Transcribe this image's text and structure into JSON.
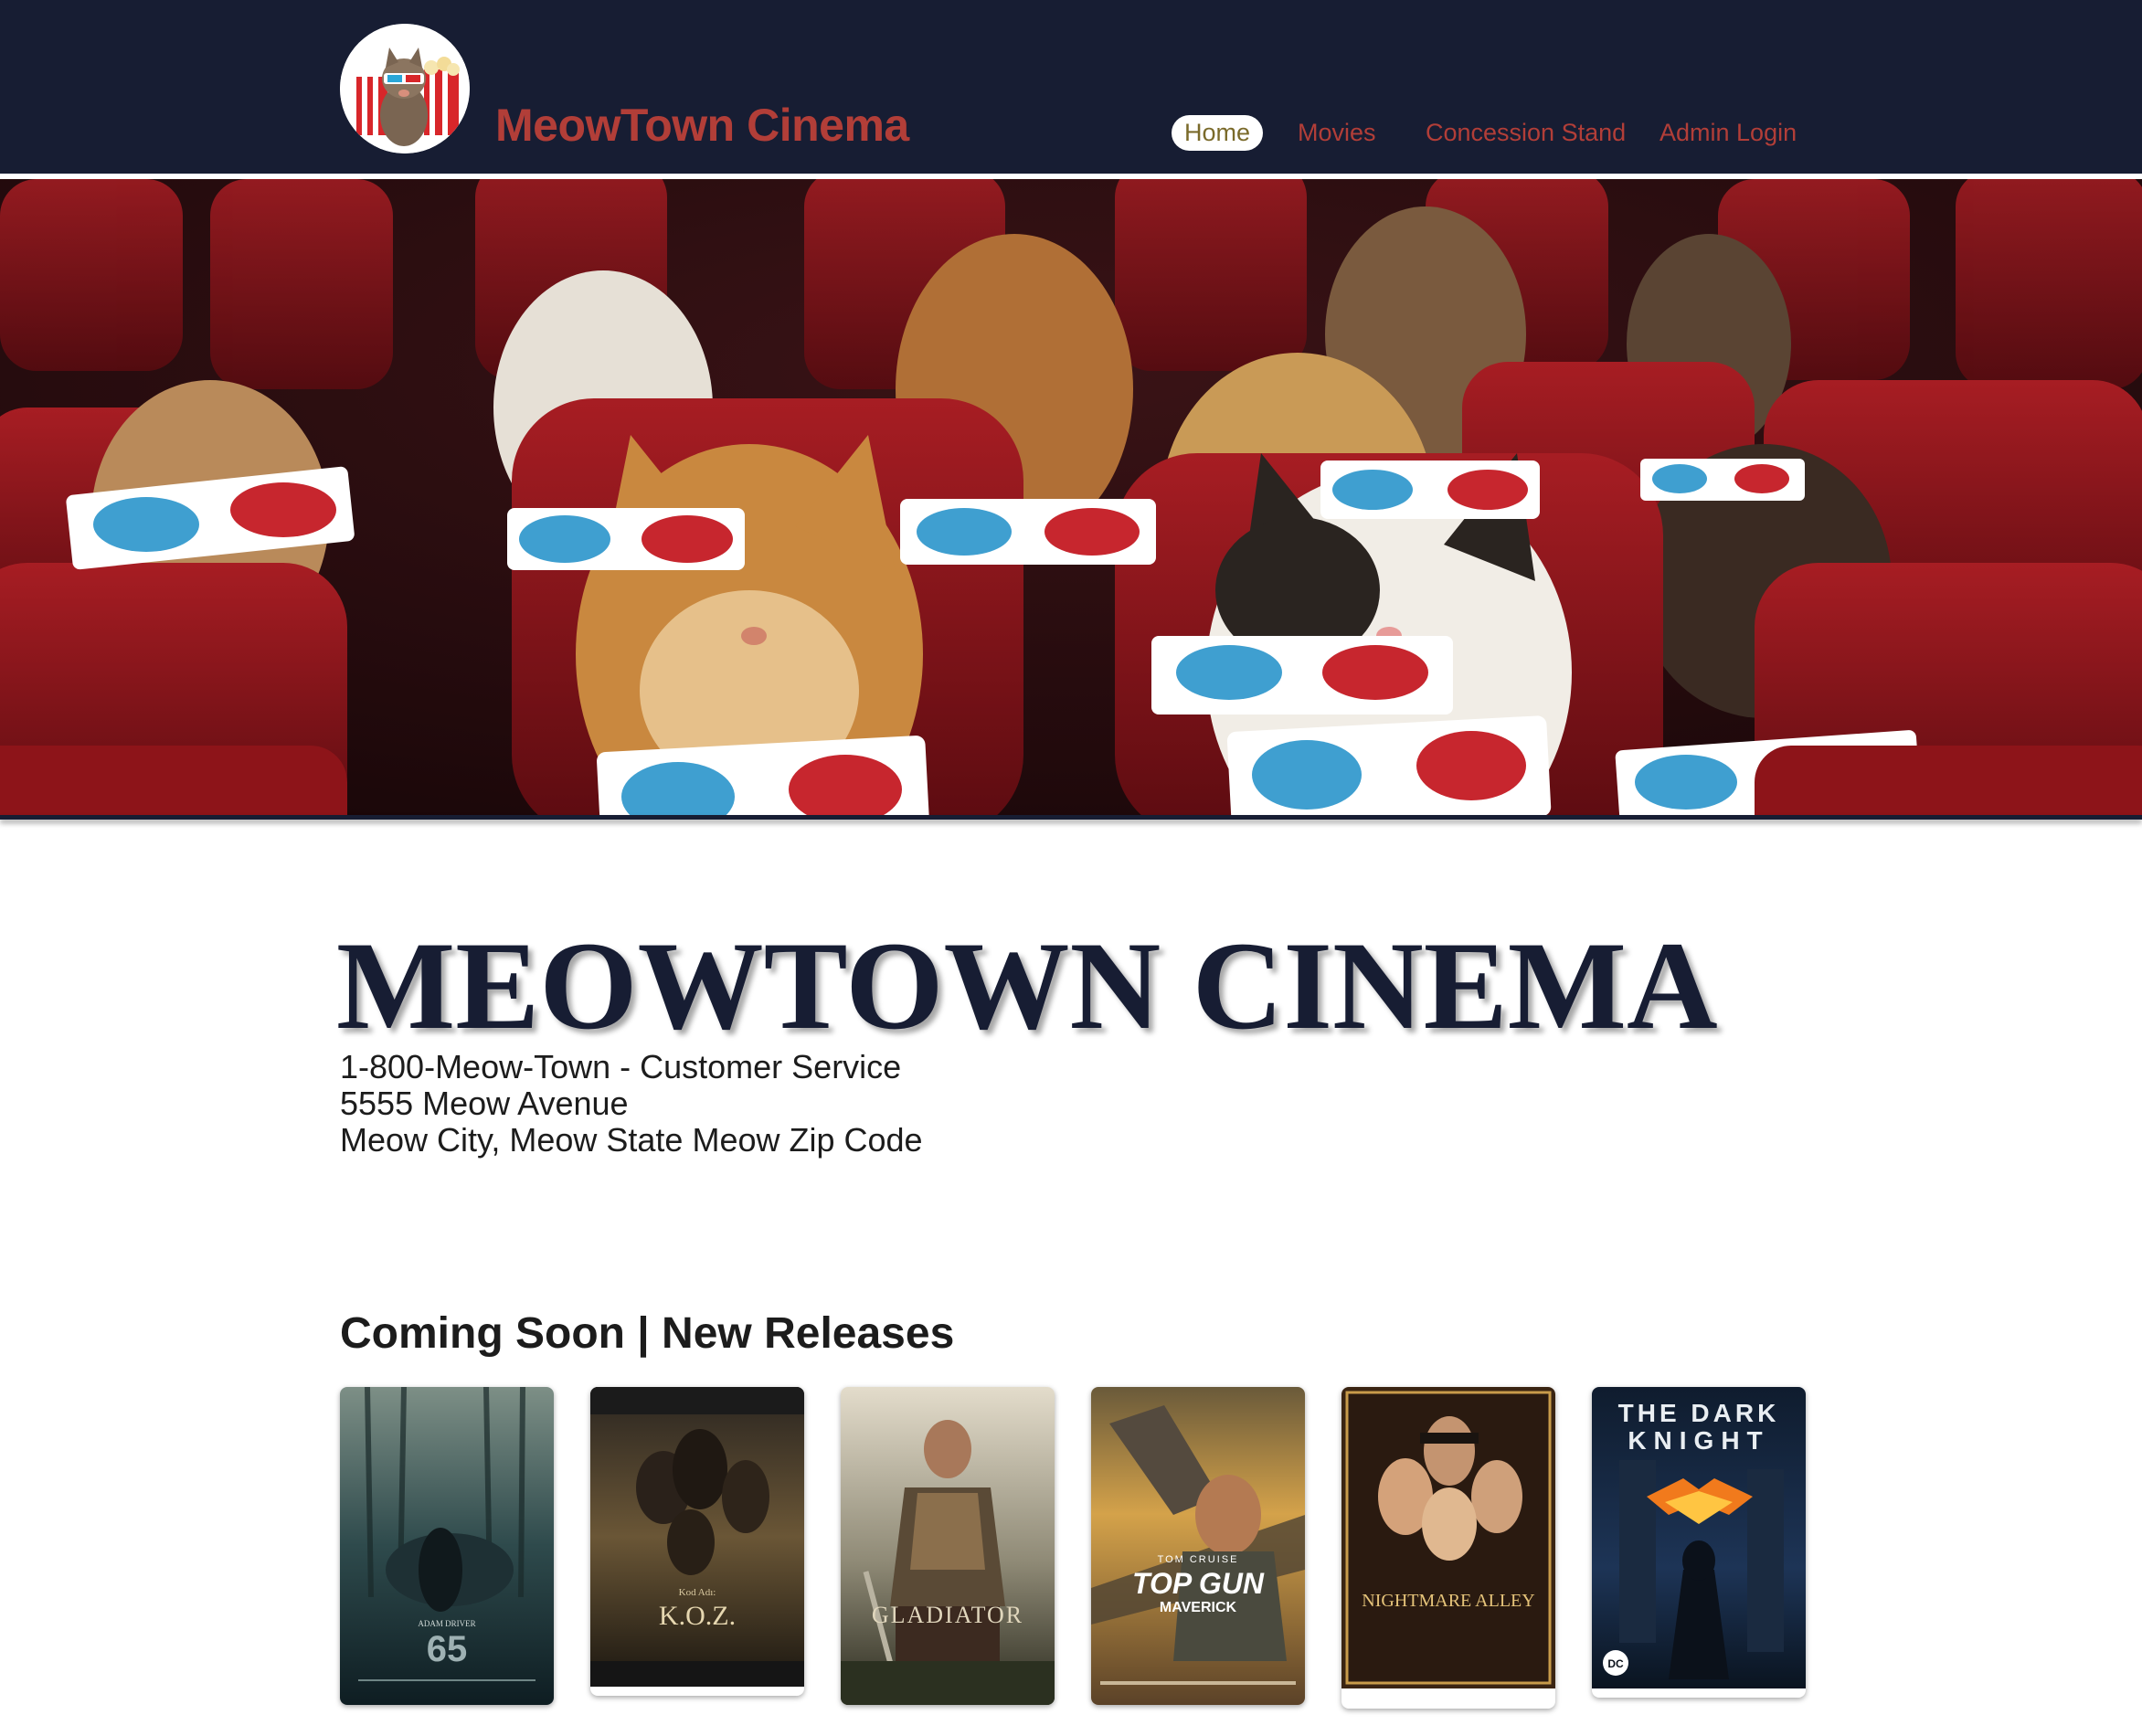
{
  "header": {
    "brand": "MeowTown Cinema",
    "nav": [
      {
        "label": "Home",
        "active": true
      },
      {
        "label": "Movies",
        "active": false
      },
      {
        "label": "Concession Stand",
        "active": false
      },
      {
        "label": "Admin Login",
        "active": false
      }
    ]
  },
  "main": {
    "title": "MEOWTOWN CINEMA",
    "phone": "1-800-Meow-Town - Customer Service",
    "address_line1": "5555 Meow Avenue",
    "address_line2": "Meow City, Meow State Meow Zip Code"
  },
  "releases": {
    "heading": "Coming Soon | New Releases",
    "posters": [
      {
        "title": "65",
        "actor": "ADAM DRIVER"
      },
      {
        "title": "K.O.Z.",
        "kicker": "Kod Adı:"
      },
      {
        "title": "GLADIATOR"
      },
      {
        "title": "TOP GUN",
        "subtitle": "MAVERICK",
        "actor": "TOM CRUISE"
      },
      {
        "title": "NIGHTMARE ALLEY"
      },
      {
        "title": "THE DARK",
        "title2": "KNIGHT",
        "badge": "DC"
      }
    ]
  },
  "colors": {
    "header_bg": "#171d33",
    "brand_red": "#b23e38",
    "title_navy": "#171d33"
  }
}
